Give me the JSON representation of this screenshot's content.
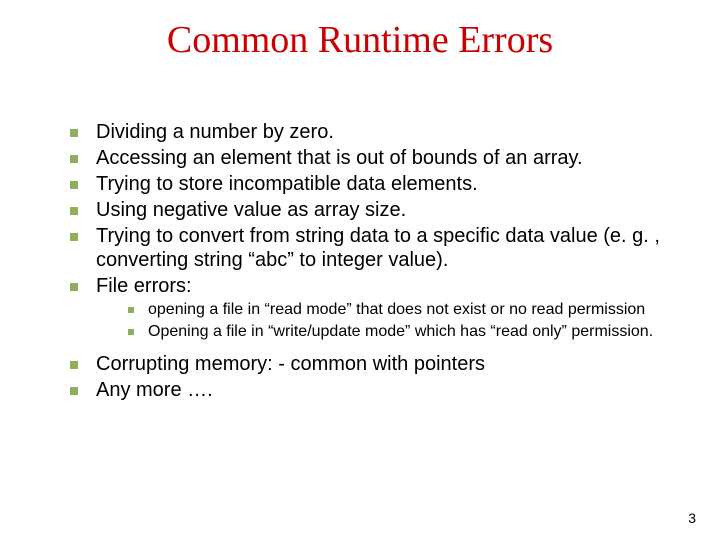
{
  "title": "Common Runtime Errors",
  "bullets": {
    "b0": "Dividing a number by zero.",
    "b1": "Accessing an element that is out of bounds of an array.",
    "b2": "Trying to store incompatible data elements.",
    "b3": "Using negative value as array size.",
    "b4": "Trying to convert from string data to a specific data value (e. g. , converting string “abc” to integer value).",
    "b5": "File errors:",
    "b5_0": "opening a file in “read mode” that does not exist or no read permission",
    "b5_1": "Opening a file in “write/update mode” which has  “read only” permission.",
    "b6": "Corrupting memory: - common with pointers",
    "b7": "Any more …."
  },
  "page_number": "3"
}
